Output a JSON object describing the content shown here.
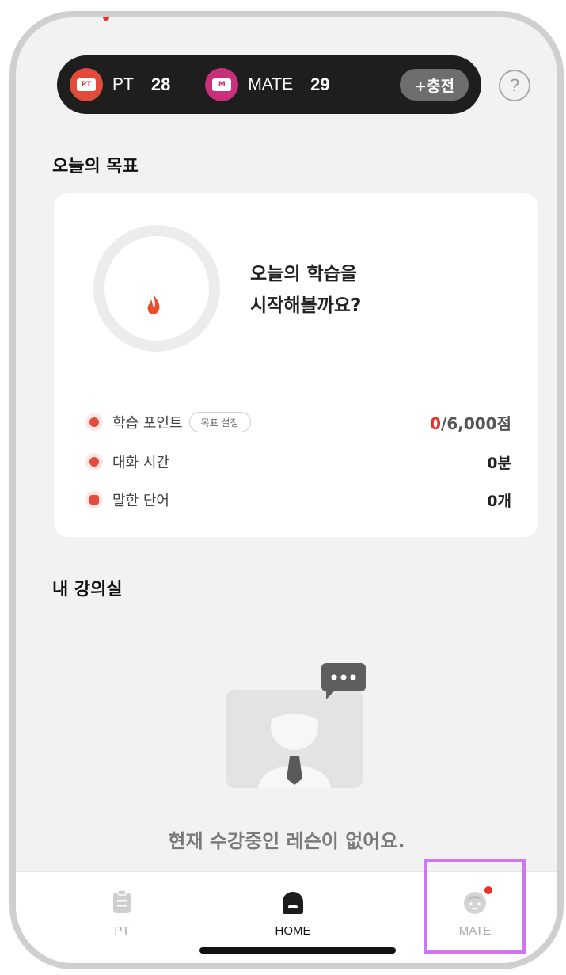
{
  "tickets": {
    "pt_label": "PT",
    "pt_count": "28",
    "mate_label": "MATE",
    "mate_count": "29",
    "charge_label": "+충전",
    "help_label": "?"
  },
  "goal": {
    "section_title": "오늘의 목표",
    "message_line1": "오늘의 학습을",
    "message_line2": "시작해볼까요?",
    "stats": {
      "points_label": "학습 포인트",
      "goal_set_label": "목표 설정",
      "points_current": "0",
      "points_target": "/6,000점",
      "talk_time_label": "대화 시간",
      "talk_time_value": "0분",
      "words_label": "말한 단어",
      "words_value": "0개"
    }
  },
  "classroom": {
    "section_title": "내 강의실",
    "empty_message": "현재 수강중인 레슨이 없어요."
  },
  "nav": {
    "items": [
      {
        "label": "PT",
        "icon": "clipboard-icon",
        "active": false
      },
      {
        "label": "HOME",
        "icon": "home-icon",
        "active": true
      },
      {
        "label": "MATE",
        "icon": "mate-face-icon",
        "active": false
      }
    ]
  },
  "colors": {
    "accent": "#e5322e",
    "ticket_bar": "#1e1e1e",
    "highlight": "#cc77ee"
  }
}
